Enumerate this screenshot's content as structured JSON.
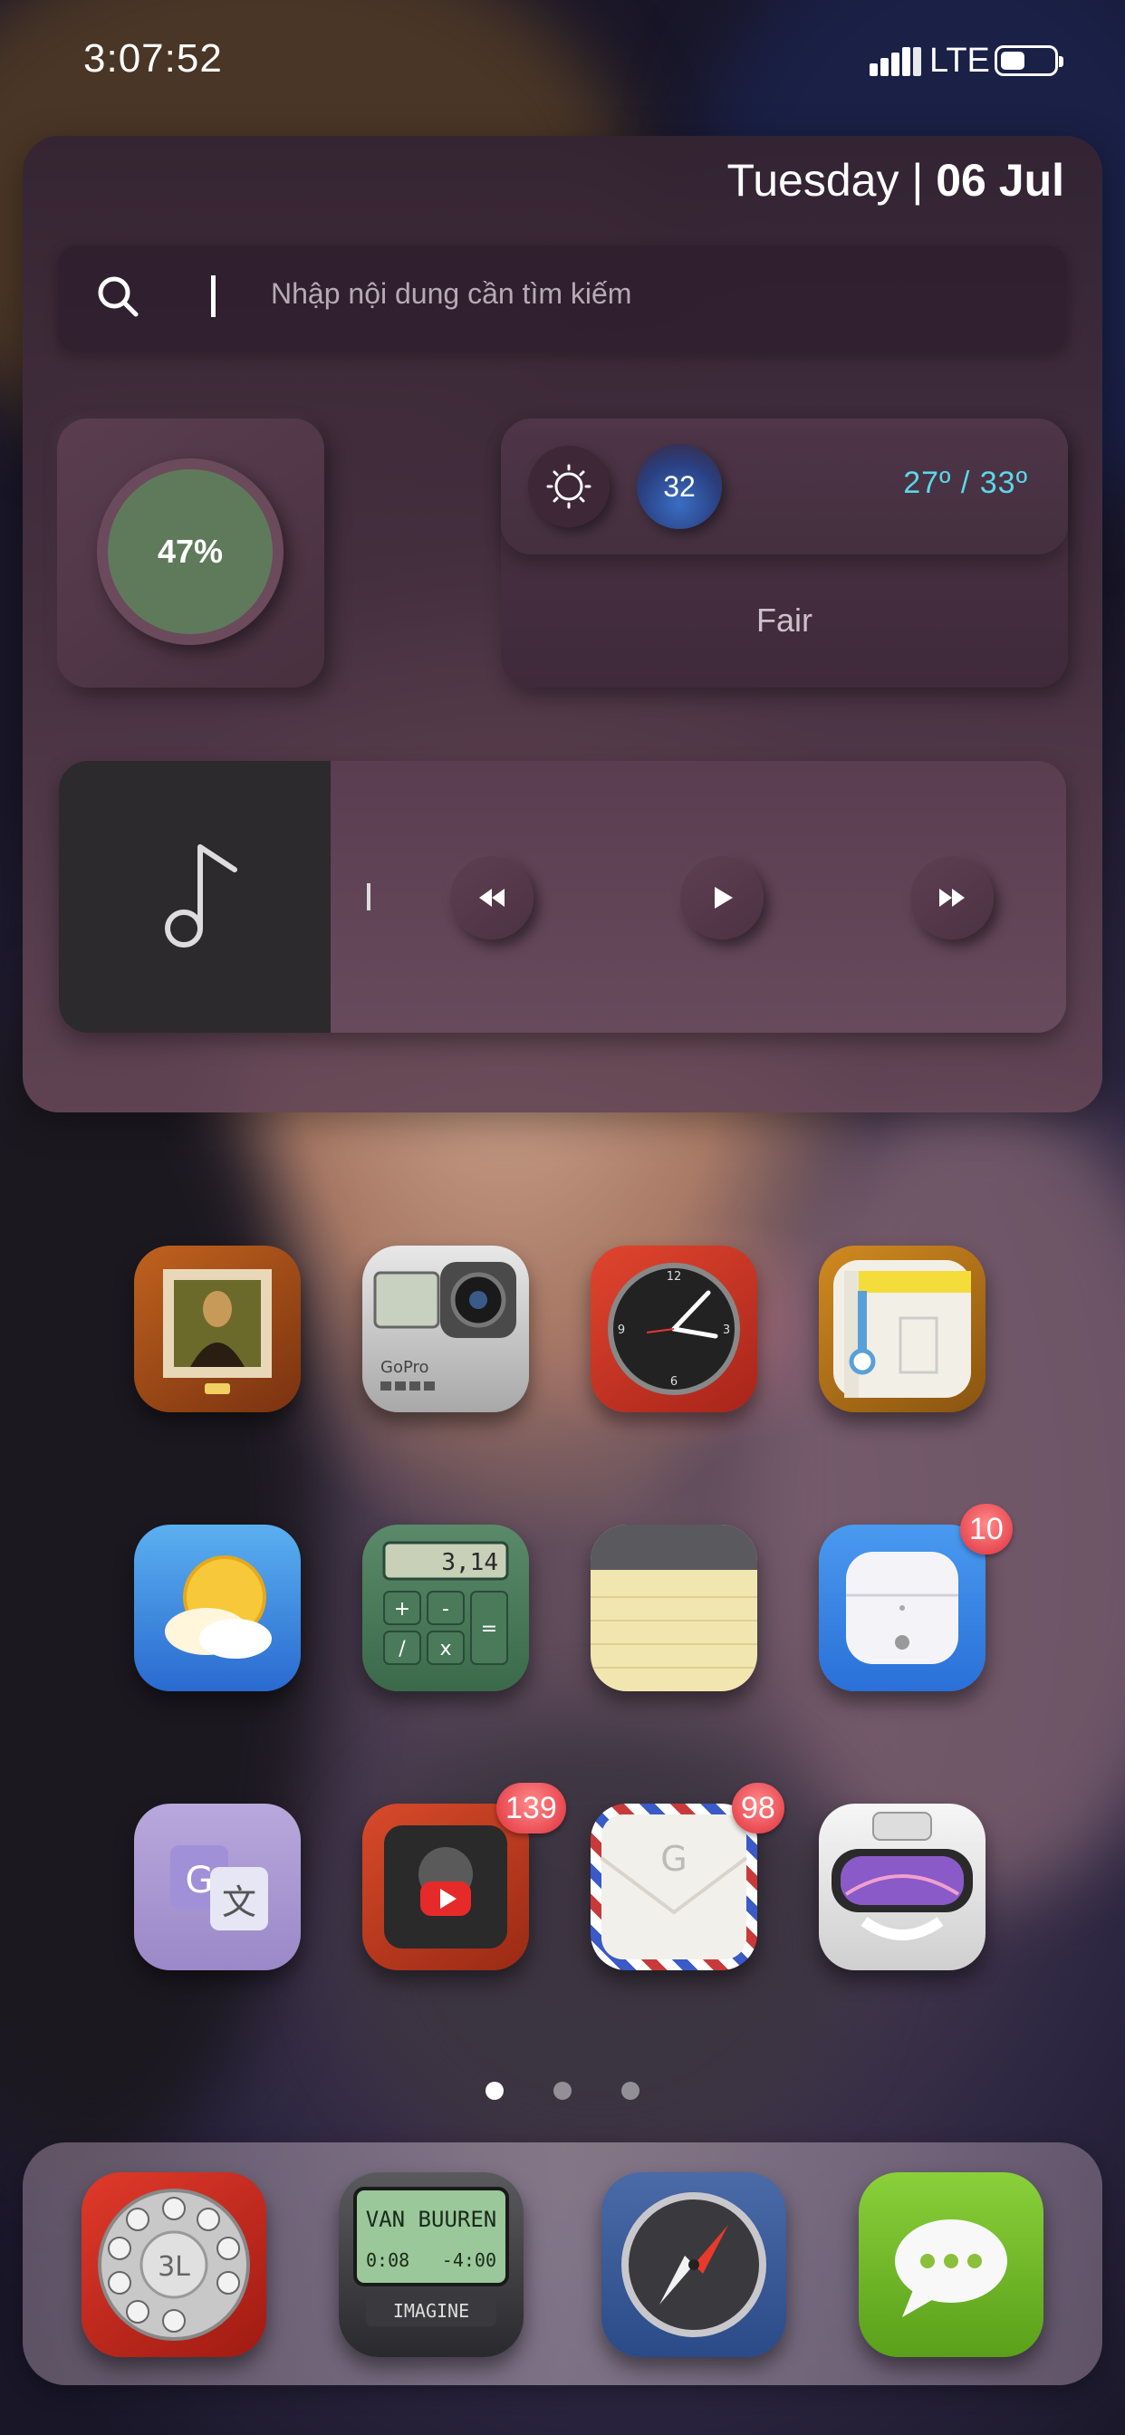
{
  "status_bar": {
    "time": "3:07:52",
    "network": "LTE"
  },
  "widget": {
    "date_day": "Tuesday",
    "date_sep": " | ",
    "date_date": "06 Jul",
    "search": {
      "placeholder": "Nhập nội dung cần tìm kiếm"
    },
    "battery": {
      "percent_label": "47%",
      "level": 0.47
    },
    "weather": {
      "temp_now": "32",
      "range": "27º / 33º",
      "condition": "Fair"
    }
  },
  "home": {
    "page_indicator": {
      "pages": 3,
      "active": 0
    },
    "apps": [
      {
        "id": "photos",
        "icon": "mona-lisa-frame-icon"
      },
      {
        "id": "camera",
        "icon": "gopro-camera-icon"
      },
      {
        "id": "clock",
        "icon": "clock-icon"
      },
      {
        "id": "maps",
        "icon": "map-icon"
      },
      {
        "id": "weather",
        "icon": "sun-cloud-icon"
      },
      {
        "id": "calculator",
        "icon": "calculator-icon",
        "display": "3,14"
      },
      {
        "id": "notes",
        "icon": "notepad-icon"
      },
      {
        "id": "airpods",
        "icon": "airpods-case-icon",
        "badge": "10"
      },
      {
        "id": "translate",
        "icon": "google-translate-icon"
      },
      {
        "id": "youtube",
        "icon": "youtube-icon",
        "badge": "139"
      },
      {
        "id": "gmail",
        "icon": "envelope-icon",
        "badge": "98"
      },
      {
        "id": "goggles",
        "icon": "ski-goggles-icon"
      }
    ],
    "dock": [
      {
        "id": "phone",
        "icon": "rotary-phone-icon"
      },
      {
        "id": "music",
        "icon": "music-player-icon",
        "line1": "VAN BUUREN",
        "line2a": "0:08",
        "line2b": "-4:00",
        "line3": "IMAGINE"
      },
      {
        "id": "safari",
        "icon": "compass-icon"
      },
      {
        "id": "messages",
        "icon": "chat-bubble-icon"
      }
    ]
  }
}
